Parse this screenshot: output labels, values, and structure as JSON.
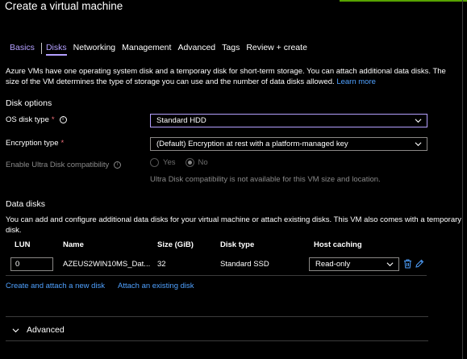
{
  "page": {
    "title": "Create a virtual machine"
  },
  "tabs": [
    {
      "label": "Basics"
    },
    {
      "label": "Disks"
    },
    {
      "label": "Networking"
    },
    {
      "label": "Management"
    },
    {
      "label": "Advanced"
    },
    {
      "label": "Tags"
    },
    {
      "label": "Review + create"
    }
  ],
  "intro": {
    "text": "Azure VMs have one operating system disk and a temporary disk for short-term storage. You can attach additional data disks. The size of the VM determines the type of storage you can use and the number of data disks allowed.",
    "learn_more": "Learn more"
  },
  "disk_options": {
    "heading": "Disk options",
    "os_disk_type": {
      "label": "OS disk type",
      "required": "*",
      "value": "Standard HDD"
    },
    "encryption_type": {
      "label": "Encryption type",
      "required": "*",
      "value": "(Default) Encryption at rest with a platform-managed key"
    },
    "ultra_disk": {
      "label": "Enable Ultra Disk compatibility",
      "options": [
        "Yes",
        "No"
      ],
      "selected": "No",
      "hint": "Ultra Disk compatibility is not available for this VM size and location."
    }
  },
  "data_disks": {
    "heading": "Data disks",
    "description": "You can add and configure additional data disks for your virtual machine or attach existing disks. This VM also comes with a temporary disk.",
    "columns": [
      "LUN",
      "Name",
      "Size (GiB)",
      "Disk type",
      "Host caching"
    ],
    "rows": [
      {
        "lun": "0",
        "name": "AZEUS2WIN10MS_Dat...",
        "size": "32",
        "disk_type": "Standard SSD",
        "host_caching": "Read-only"
      }
    ],
    "create_link": "Create and attach a new disk",
    "attach_link": "Attach an existing disk"
  },
  "advanced_section": {
    "label": "Advanced"
  },
  "colors": {
    "accent": "#b4a0ff",
    "link": "#4fa1ff",
    "required": "#f1707b",
    "progress": "#57a300"
  },
  "icons": [
    "info-icon",
    "chevron-down-icon",
    "delete-icon",
    "edit-icon"
  ]
}
